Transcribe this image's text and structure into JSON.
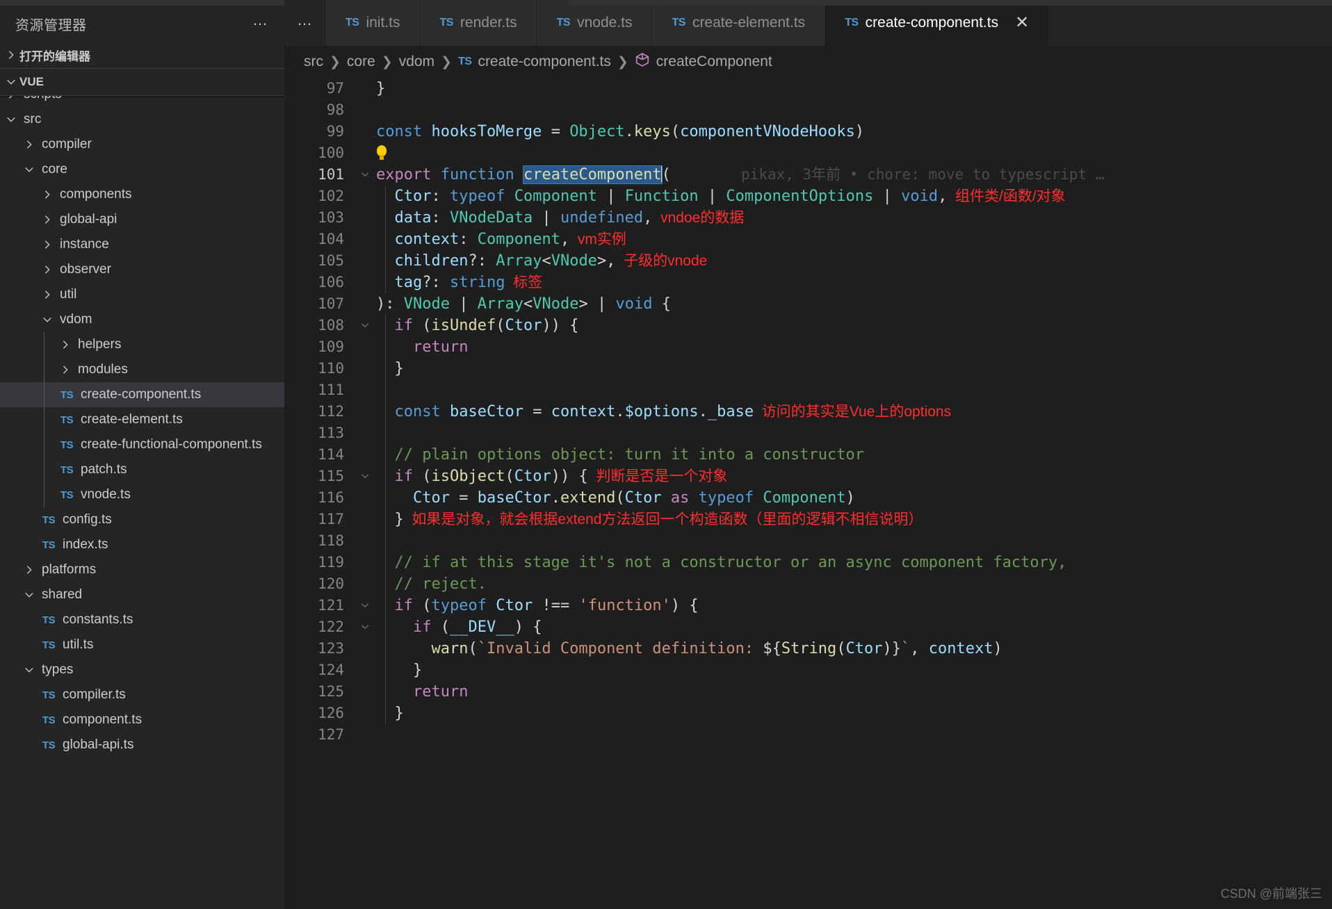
{
  "sidebar": {
    "title": "资源管理器",
    "more_label": "…",
    "open_editors_label": "打开的编辑器",
    "project_label": "VUE",
    "items": [
      {
        "label": "scripts",
        "type": "folder",
        "state": "collapsed",
        "depth": 1,
        "clipped": true
      },
      {
        "label": "src",
        "type": "folder",
        "state": "expanded",
        "depth": 1
      },
      {
        "label": "compiler",
        "type": "folder",
        "state": "collapsed",
        "depth": 2
      },
      {
        "label": "core",
        "type": "folder",
        "state": "expanded",
        "depth": 2
      },
      {
        "label": "components",
        "type": "folder",
        "state": "collapsed",
        "depth": 3
      },
      {
        "label": "global-api",
        "type": "folder",
        "state": "collapsed",
        "depth": 3
      },
      {
        "label": "instance",
        "type": "folder",
        "state": "collapsed",
        "depth": 3
      },
      {
        "label": "observer",
        "type": "folder",
        "state": "collapsed",
        "depth": 3
      },
      {
        "label": "util",
        "type": "folder",
        "state": "collapsed",
        "depth": 3
      },
      {
        "label": "vdom",
        "type": "folder",
        "state": "expanded",
        "depth": 3
      },
      {
        "label": "helpers",
        "type": "folder",
        "state": "collapsed",
        "depth": 4
      },
      {
        "label": "modules",
        "type": "folder",
        "state": "collapsed",
        "depth": 4
      },
      {
        "label": "create-component.ts",
        "type": "file",
        "icon": "TS",
        "depth": 4,
        "selected": true
      },
      {
        "label": "create-element.ts",
        "type": "file",
        "icon": "TS",
        "depth": 4
      },
      {
        "label": "create-functional-component.ts",
        "type": "file",
        "icon": "TS",
        "depth": 4
      },
      {
        "label": "patch.ts",
        "type": "file",
        "icon": "TS",
        "depth": 4
      },
      {
        "label": "vnode.ts",
        "type": "file",
        "icon": "TS",
        "depth": 4
      },
      {
        "label": "config.ts",
        "type": "file",
        "icon": "TS",
        "depth": 3
      },
      {
        "label": "index.ts",
        "type": "file",
        "icon": "TS",
        "depth": 3
      },
      {
        "label": "platforms",
        "type": "folder",
        "state": "collapsed",
        "depth": 2
      },
      {
        "label": "shared",
        "type": "folder",
        "state": "expanded",
        "depth": 2
      },
      {
        "label": "constants.ts",
        "type": "file",
        "icon": "TS",
        "depth": 3
      },
      {
        "label": "util.ts",
        "type": "file",
        "icon": "TS",
        "depth": 3
      },
      {
        "label": "types",
        "type": "folder",
        "state": "expanded",
        "depth": 2
      },
      {
        "label": "compiler.ts",
        "type": "file",
        "icon": "TS",
        "depth": 3
      },
      {
        "label": "component.ts",
        "type": "file",
        "icon": "TS",
        "depth": 3
      },
      {
        "label": "global-api.ts",
        "type": "file",
        "icon": "TS",
        "depth": 3,
        "clipped": true
      }
    ]
  },
  "tabbar": {
    "more_label": "…",
    "tabs": [
      {
        "label": "init.ts",
        "icon": "TS",
        "active": false
      },
      {
        "label": "render.ts",
        "icon": "TS",
        "active": false
      },
      {
        "label": "vnode.ts",
        "icon": "TS",
        "active": false
      },
      {
        "label": "create-element.ts",
        "icon": "TS",
        "active": false
      },
      {
        "label": "create-component.ts",
        "icon": "TS",
        "active": true,
        "close_label": "✕"
      }
    ]
  },
  "breadcrumbs": {
    "items": [
      {
        "label": "src",
        "icon": null
      },
      {
        "label": "core",
        "icon": null
      },
      {
        "label": "vdom",
        "icon": null
      },
      {
        "label": "create-component.ts",
        "icon": "TS"
      },
      {
        "label": "createComponent",
        "icon": "symbol-cube"
      }
    ],
    "separator": "❯"
  },
  "editor": {
    "blame_line": "pikax, 3年前 • chore: move to typescript …",
    "first_line_number": 97,
    "last_line_number": 127,
    "selection_text": "createComponent",
    "lines": [
      {
        "n": 97,
        "html": "<span class=\"pun\">}</span>"
      },
      {
        "n": 98,
        "html": ""
      },
      {
        "n": 99,
        "html": "<span class=\"kw2\">const</span> <span class=\"var\">hooksToMerge</span> <span class=\"op\">=</span> <span class=\"typ\">Object</span><span class=\"pun\">.</span><span class=\"fn\">keys</span><span class=\"pun\">(</span><span class=\"var\">componentVNodeHooks</span><span class=\"pun\">)</span>"
      },
      {
        "n": 100,
        "html": "<span class=\"bulb\"></span>",
        "bulb": true
      },
      {
        "n": 101,
        "html": "<span class=\"kw\">export</span> <span class=\"kw2\">function</span> <span class=\"sel-hl fn\">createComponent</span><span class=\"cursor\"></span><span class=\"pun\">(</span>",
        "fold": "open",
        "blame": true
      },
      {
        "n": 102,
        "html": "  <span class=\"var\">Ctor</span><span class=\"pun\">:</span> <span class=\"kw2\">typeof</span> <span class=\"typ\">Component</span> <span class=\"pun\">|</span> <span class=\"typ\">Function</span> <span class=\"pun\">|</span> <span class=\"typ\">ComponentOptions</span> <span class=\"pun\">|</span> <span class=\"kw2\">void</span><span class=\"pun\">,</span>",
        "annotation": "组件类/函数/对象"
      },
      {
        "n": 103,
        "html": "  <span class=\"var\">data</span><span class=\"pun\">:</span> <span class=\"typ\">VNodeData</span> <span class=\"pun\">|</span> <span class=\"kw2\">undefined</span><span class=\"pun\">,</span>",
        "annotation": "vndoe的数据"
      },
      {
        "n": 104,
        "html": "  <span class=\"var\">context</span><span class=\"pun\">:</span> <span class=\"typ\">Component</span><span class=\"pun\">,</span>",
        "annotation": "vm实例"
      },
      {
        "n": 105,
        "html": "  <span class=\"var\">children</span><span class=\"pun\">?:</span> <span class=\"typ\">Array</span><span class=\"pun\">&lt;</span><span class=\"typ\">VNode</span><span class=\"pun\">&gt;,</span>",
        "annotation": "子级的vnode"
      },
      {
        "n": 106,
        "html": "  <span class=\"var\">tag</span><span class=\"pun\">?:</span> <span class=\"kw2\">string</span>",
        "annotation": "标签"
      },
      {
        "n": 107,
        "html": "<span class=\"pun\">):</span> <span class=\"typ\">VNode</span> <span class=\"pun\">|</span> <span class=\"typ\">Array</span><span class=\"pun\">&lt;</span><span class=\"typ\">VNode</span><span class=\"pun\">&gt;</span> <span class=\"pun\">|</span> <span class=\"kw2\">void</span> <span class=\"pun\">{</span>"
      },
      {
        "n": 108,
        "html": "  <span class=\"kw\">if</span> <span class=\"pun\">(</span><span class=\"fn\">isUndef</span><span class=\"pun\">(</span><span class=\"var\">Ctor</span><span class=\"pun\">))</span> <span class=\"pun\">{</span>",
        "fold": "open"
      },
      {
        "n": 109,
        "html": "    <span class=\"kw\">return</span>"
      },
      {
        "n": 110,
        "html": "  <span class=\"pun\">}</span>"
      },
      {
        "n": 111,
        "html": ""
      },
      {
        "n": 112,
        "html": "  <span class=\"kw2\">const</span> <span class=\"var\">baseCtor</span> <span class=\"op\">=</span> <span class=\"var\">context</span><span class=\"pun\">.</span><span class=\"var\">$options</span><span class=\"pun\">.</span><span class=\"var\">_base</span>",
        "annotation": "访问的其实是Vue上的options"
      },
      {
        "n": 113,
        "html": ""
      },
      {
        "n": 114,
        "html": "  <span class=\"com\">// plain options object: turn it into a constructor</span>"
      },
      {
        "n": 115,
        "html": "  <span class=\"kw\">if</span> <span class=\"pun\">(</span><span class=\"fn\">isObject</span><span class=\"pun\">(</span><span class=\"var\">Ctor</span><span class=\"pun\">))</span> <span class=\"pun\">{</span>",
        "fold": "open",
        "annotation": "判断是否是一个对象"
      },
      {
        "n": 116,
        "html": "    <span class=\"var\">Ctor</span> <span class=\"op\">=</span> <span class=\"var\">baseCtor</span><span class=\"pun\">.</span><span class=\"fn\">extend</span><span class=\"pun\">(</span><span class=\"var\">Ctor</span> <span class=\"kw\">as</span> <span class=\"kw2\">typeof</span> <span class=\"typ\">Component</span><span class=\"pun\">)</span>"
      },
      {
        "n": 117,
        "html": "  <span class=\"pun\">}</span>",
        "annotation": "如果是对象，就会根据extend方法返回一个构造函数（里面的逻辑不相信说明）"
      },
      {
        "n": 118,
        "html": ""
      },
      {
        "n": 119,
        "html": "  <span class=\"com\">// if at this stage it's not a constructor or an async component factory,</span>"
      },
      {
        "n": 120,
        "html": "  <span class=\"com\">// reject.</span>"
      },
      {
        "n": 121,
        "html": "  <span class=\"kw\">if</span> <span class=\"pun\">(</span><span class=\"kw2\">typeof</span> <span class=\"var\">Ctor</span> <span class=\"op\">!==</span> <span class=\"str\">'function'</span><span class=\"pun\">)</span> <span class=\"pun\">{</span>",
        "fold": "open"
      },
      {
        "n": 122,
        "html": "    <span class=\"kw\">if</span> <span class=\"pun\">(</span><span class=\"var\">__DEV__</span><span class=\"pun\">)</span> <span class=\"pun\">{</span>",
        "fold": "open"
      },
      {
        "n": 123,
        "html": "      <span class=\"fn\">warn</span><span class=\"pun\">(</span><span class=\"str\">`Invalid Component definition: </span><span class=\"pun\">${</span><span class=\"fn\">String</span><span class=\"pun\">(</span><span class=\"var\">Ctor</span><span class=\"pun\">)}</span><span class=\"str\">`</span><span class=\"pun\">,</span> <span class=\"var\">context</span><span class=\"pun\">)</span>"
      },
      {
        "n": 124,
        "html": "    <span class=\"pun\">}</span>"
      },
      {
        "n": 125,
        "html": "    <span class=\"kw\">return</span>"
      },
      {
        "n": 126,
        "html": "  <span class=\"pun\">}</span>"
      },
      {
        "n": 127,
        "html": ""
      }
    ]
  },
  "watermark": "CSDN @前端张三",
  "colors": {
    "accent_blue": "#4e9bd4",
    "annotation_red": "#ff2d2d",
    "selection_blue": "#2a5a8c",
    "editor_bg": "#1e1e1e",
    "sidebar_bg": "#252526"
  }
}
